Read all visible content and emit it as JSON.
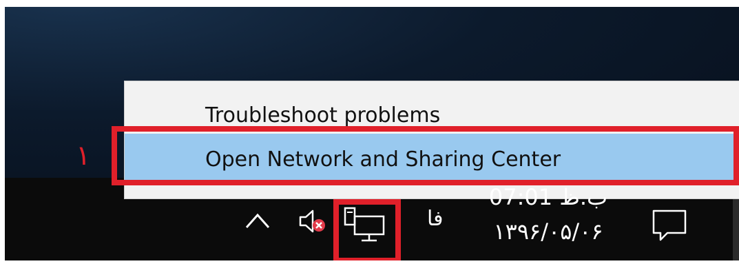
{
  "context_menu": {
    "items": [
      {
        "label": "Troubleshoot problems"
      },
      {
        "label": "Open Network and Sharing Center",
        "highlighted": true
      }
    ]
  },
  "annotation": {
    "step_number": "۱",
    "color": "#e0202a"
  },
  "system_tray": {
    "icons": [
      "show-hidden-icons-chevron-icon",
      "speaker-muted-icon",
      "network-icon",
      "action-center-icon"
    ],
    "language": "فا",
    "time": "07:01 ب.ظ",
    "date": "۱۳۹۶/۰۵/۰۶"
  },
  "colors": {
    "highlight": "#99c9ef",
    "taskbar": "#0b0b0b",
    "menu": "#f2f2f2"
  }
}
